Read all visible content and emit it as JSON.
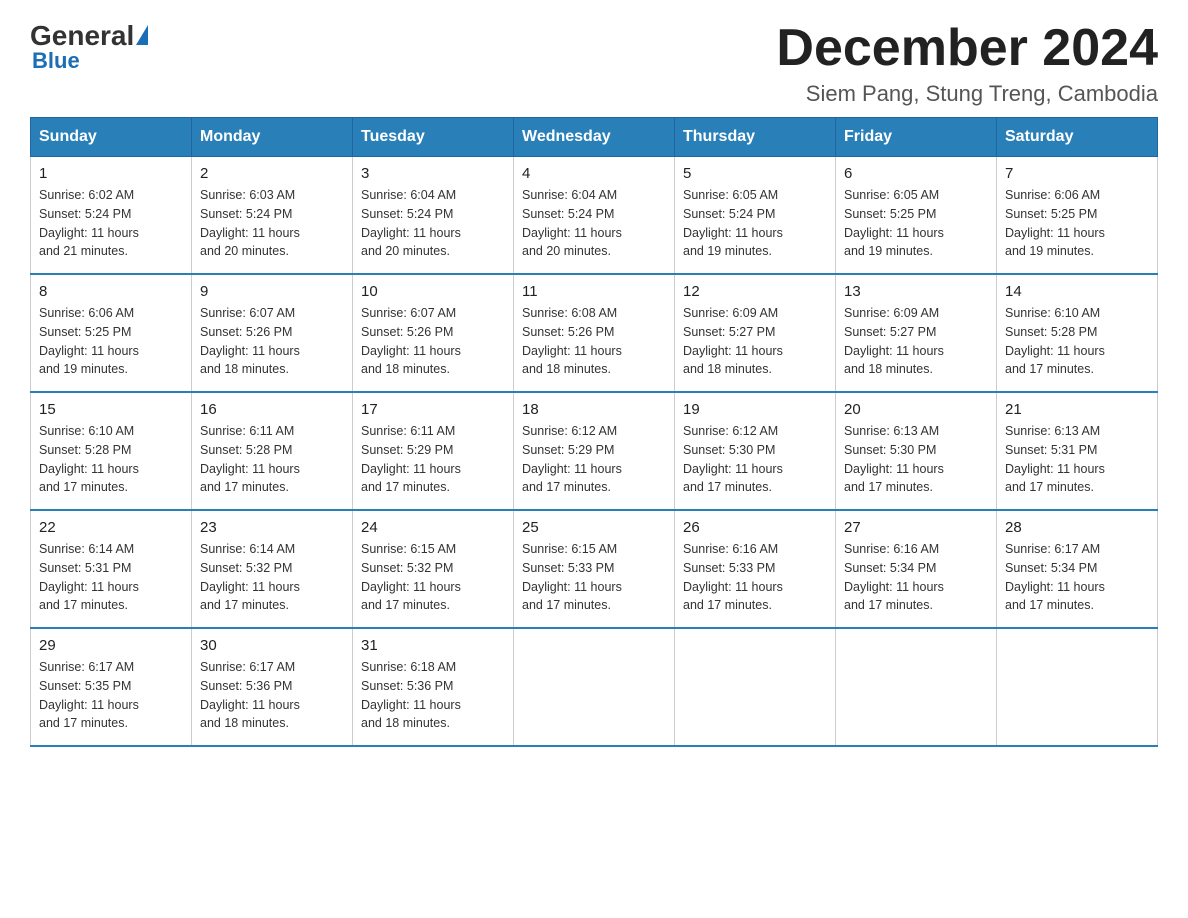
{
  "logo": {
    "general": "General",
    "triangle": "",
    "blue": "Blue"
  },
  "title": "December 2024",
  "subtitle": "Siem Pang, Stung Treng, Cambodia",
  "days_header": [
    "Sunday",
    "Monday",
    "Tuesday",
    "Wednesday",
    "Thursday",
    "Friday",
    "Saturday"
  ],
  "weeks": [
    [
      {
        "day": "1",
        "sunrise": "6:02 AM",
        "sunset": "5:24 PM",
        "daylight": "11 hours and 21 minutes."
      },
      {
        "day": "2",
        "sunrise": "6:03 AM",
        "sunset": "5:24 PM",
        "daylight": "11 hours and 20 minutes."
      },
      {
        "day": "3",
        "sunrise": "6:04 AM",
        "sunset": "5:24 PM",
        "daylight": "11 hours and 20 minutes."
      },
      {
        "day": "4",
        "sunrise": "6:04 AM",
        "sunset": "5:24 PM",
        "daylight": "11 hours and 20 minutes."
      },
      {
        "day": "5",
        "sunrise": "6:05 AM",
        "sunset": "5:24 PM",
        "daylight": "11 hours and 19 minutes."
      },
      {
        "day": "6",
        "sunrise": "6:05 AM",
        "sunset": "5:25 PM",
        "daylight": "11 hours and 19 minutes."
      },
      {
        "day": "7",
        "sunrise": "6:06 AM",
        "sunset": "5:25 PM",
        "daylight": "11 hours and 19 minutes."
      }
    ],
    [
      {
        "day": "8",
        "sunrise": "6:06 AM",
        "sunset": "5:25 PM",
        "daylight": "11 hours and 19 minutes."
      },
      {
        "day": "9",
        "sunrise": "6:07 AM",
        "sunset": "5:26 PM",
        "daylight": "11 hours and 18 minutes."
      },
      {
        "day": "10",
        "sunrise": "6:07 AM",
        "sunset": "5:26 PM",
        "daylight": "11 hours and 18 minutes."
      },
      {
        "day": "11",
        "sunrise": "6:08 AM",
        "sunset": "5:26 PM",
        "daylight": "11 hours and 18 minutes."
      },
      {
        "day": "12",
        "sunrise": "6:09 AM",
        "sunset": "5:27 PM",
        "daylight": "11 hours and 18 minutes."
      },
      {
        "day": "13",
        "sunrise": "6:09 AM",
        "sunset": "5:27 PM",
        "daylight": "11 hours and 18 minutes."
      },
      {
        "day": "14",
        "sunrise": "6:10 AM",
        "sunset": "5:28 PM",
        "daylight": "11 hours and 17 minutes."
      }
    ],
    [
      {
        "day": "15",
        "sunrise": "6:10 AM",
        "sunset": "5:28 PM",
        "daylight": "11 hours and 17 minutes."
      },
      {
        "day": "16",
        "sunrise": "6:11 AM",
        "sunset": "5:28 PM",
        "daylight": "11 hours and 17 minutes."
      },
      {
        "day": "17",
        "sunrise": "6:11 AM",
        "sunset": "5:29 PM",
        "daylight": "11 hours and 17 minutes."
      },
      {
        "day": "18",
        "sunrise": "6:12 AM",
        "sunset": "5:29 PM",
        "daylight": "11 hours and 17 minutes."
      },
      {
        "day": "19",
        "sunrise": "6:12 AM",
        "sunset": "5:30 PM",
        "daylight": "11 hours and 17 minutes."
      },
      {
        "day": "20",
        "sunrise": "6:13 AM",
        "sunset": "5:30 PM",
        "daylight": "11 hours and 17 minutes."
      },
      {
        "day": "21",
        "sunrise": "6:13 AM",
        "sunset": "5:31 PM",
        "daylight": "11 hours and 17 minutes."
      }
    ],
    [
      {
        "day": "22",
        "sunrise": "6:14 AM",
        "sunset": "5:31 PM",
        "daylight": "11 hours and 17 minutes."
      },
      {
        "day": "23",
        "sunrise": "6:14 AM",
        "sunset": "5:32 PM",
        "daylight": "11 hours and 17 minutes."
      },
      {
        "day": "24",
        "sunrise": "6:15 AM",
        "sunset": "5:32 PM",
        "daylight": "11 hours and 17 minutes."
      },
      {
        "day": "25",
        "sunrise": "6:15 AM",
        "sunset": "5:33 PM",
        "daylight": "11 hours and 17 minutes."
      },
      {
        "day": "26",
        "sunrise": "6:16 AM",
        "sunset": "5:33 PM",
        "daylight": "11 hours and 17 minutes."
      },
      {
        "day": "27",
        "sunrise": "6:16 AM",
        "sunset": "5:34 PM",
        "daylight": "11 hours and 17 minutes."
      },
      {
        "day": "28",
        "sunrise": "6:17 AM",
        "sunset": "5:34 PM",
        "daylight": "11 hours and 17 minutes."
      }
    ],
    [
      {
        "day": "29",
        "sunrise": "6:17 AM",
        "sunset": "5:35 PM",
        "daylight": "11 hours and 17 minutes."
      },
      {
        "day": "30",
        "sunrise": "6:17 AM",
        "sunset": "5:36 PM",
        "daylight": "11 hours and 18 minutes."
      },
      {
        "day": "31",
        "sunrise": "6:18 AM",
        "sunset": "5:36 PM",
        "daylight": "11 hours and 18 minutes."
      },
      null,
      null,
      null,
      null
    ]
  ],
  "labels": {
    "sunrise": "Sunrise:",
    "sunset": "Sunset:",
    "daylight": "Daylight:"
  }
}
